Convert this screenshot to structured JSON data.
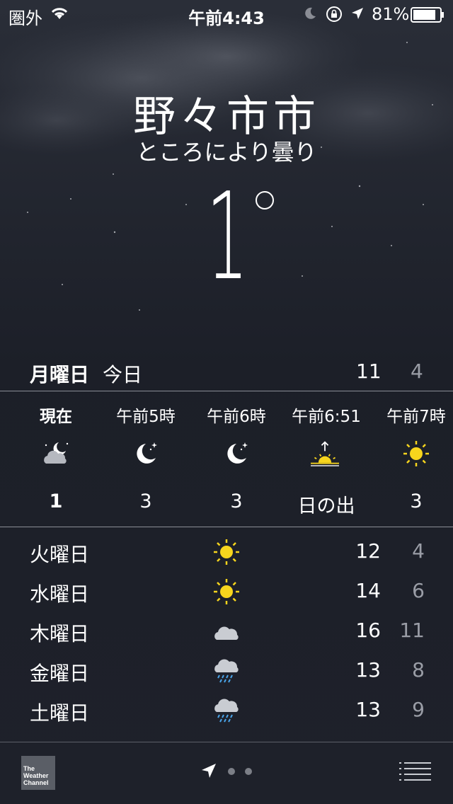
{
  "status_bar": {
    "carrier": "圏外",
    "time": "午前4:43",
    "battery_pct": "81%"
  },
  "location": {
    "city": "野々市市",
    "condition": "ところにより曇り",
    "temperature": "1"
  },
  "today": {
    "day": "月曜日",
    "label": "今日",
    "high": "11",
    "low": "4"
  },
  "hourly": [
    {
      "time": "現在",
      "icon": "cloud-moon-icon",
      "temp": "1"
    },
    {
      "time": "午前5時",
      "icon": "moon-stars-icon",
      "temp": "3"
    },
    {
      "time": "午前6時",
      "icon": "moon-stars-icon",
      "temp": "3"
    },
    {
      "time": "午前6:51",
      "icon": "sunrise-icon",
      "temp": "日の出"
    },
    {
      "time": "午前7時",
      "icon": "sun-icon",
      "temp": "3"
    }
  ],
  "daily": [
    {
      "day": "火曜日",
      "icon": "sun-icon",
      "high": "12",
      "low": "4"
    },
    {
      "day": "水曜日",
      "icon": "sun-icon",
      "high": "14",
      "low": "6"
    },
    {
      "day": "木曜日",
      "icon": "cloud-icon",
      "high": "16",
      "low": "11"
    },
    {
      "day": "金曜日",
      "icon": "rain-icon",
      "high": "13",
      "low": "8"
    },
    {
      "day": "土曜日",
      "icon": "rain-icon",
      "high": "13",
      "low": "9"
    }
  ],
  "bottom_bar": {
    "logo_lines": [
      "The",
      "Weather",
      "Channel"
    ]
  },
  "colors": {
    "background": "#1d2029",
    "sun": "#f7d51d",
    "low_temp": "#9a9da6",
    "divider": "#8b8e96"
  }
}
